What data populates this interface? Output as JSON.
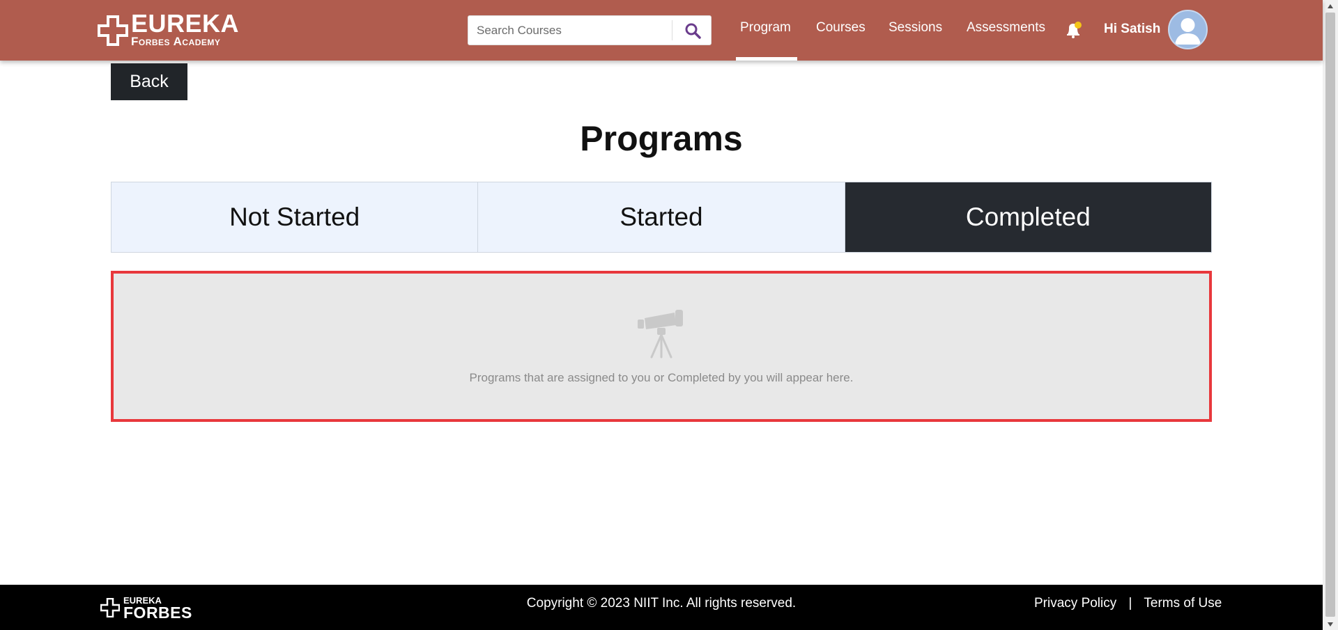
{
  "header": {
    "logo_line1": "EUREKA",
    "logo_line2": "Forbes Academy",
    "search_placeholder": "Search Courses",
    "nav": [
      "Program",
      "Courses",
      "Sessions",
      "Assessments"
    ],
    "active_nav": "Program",
    "greeting": "Hi Satish",
    "colors": {
      "header_bg": "#b05c4e",
      "search_icon": "#6a3c8c",
      "bell_dot": "#f5c518"
    }
  },
  "back_label": "Back",
  "page_title": "Programs",
  "tabs": [
    {
      "label": "Not Started",
      "active": false
    },
    {
      "label": "Started",
      "active": false
    },
    {
      "label": "Completed",
      "active": true
    }
  ],
  "empty_state": {
    "icon": "telescope-icon",
    "message": "Programs that are assigned to you or Completed by you will appear here."
  },
  "footer": {
    "logo_line1": "EUREKA",
    "logo_line2": "FORBES",
    "copyright": "Copyright © 2023 NIIT Inc. All rights reserved.",
    "privacy": "Privacy Policy",
    "separator": "|",
    "terms": "Terms of Use"
  }
}
